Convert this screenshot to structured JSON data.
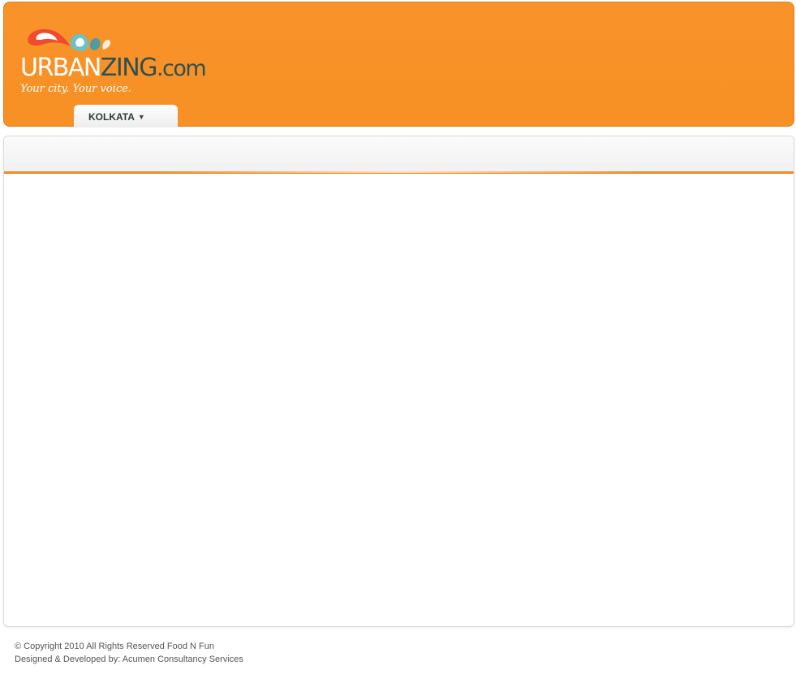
{
  "header": {
    "logo": {
      "text_urban": "URBAN",
      "text_zing": "ZING",
      "text_com": ".com",
      "tagline": "Your city. Your voice.",
      "colors": {
        "drop_red": "#ef4b2e",
        "drop_teal": "#6cc1c4",
        "text_dark": "#2f4f52"
      }
    },
    "city_selector": {
      "label": "KOLKATA",
      "arrow": "▼"
    },
    "background_color": "#f8922a"
  },
  "content": {
    "accent_color": "#f08a2b"
  },
  "footer": {
    "copyright": "© Copyright 2010 All Rights Reserved Food N Fun",
    "credits": "Designed & Developed by: Acumen Consultancy Services"
  }
}
